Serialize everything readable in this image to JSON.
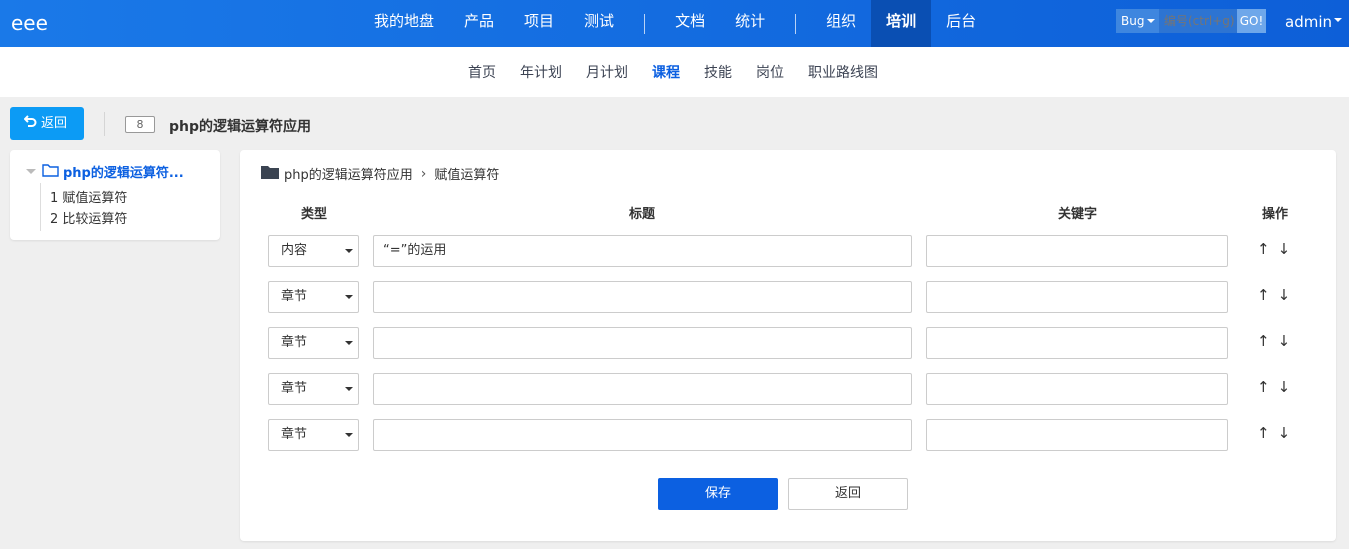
{
  "brand": "eee",
  "mainnav": [
    {
      "label": "我的地盘"
    },
    {
      "label": "产品"
    },
    {
      "label": "项目"
    },
    {
      "label": "测试"
    },
    {
      "label": "文档"
    },
    {
      "label": "统计"
    },
    {
      "label": "组织"
    },
    {
      "label": "培训",
      "active": true
    },
    {
      "label": "后台"
    }
  ],
  "search": {
    "type": "Bug",
    "placeholder": "编号(ctrl+g)",
    "go": "GO!"
  },
  "user": "admin",
  "subnav": [
    {
      "label": "首页"
    },
    {
      "label": "年计划"
    },
    {
      "label": "月计划"
    },
    {
      "label": "课程",
      "active": true
    },
    {
      "label": "技能"
    },
    {
      "label": "岗位"
    },
    {
      "label": "职业路线图"
    }
  ],
  "header": {
    "back_label": "返回",
    "badge": "8",
    "title": "php的逻辑运算符应用"
  },
  "tree": {
    "root": "php的逻辑运算符...",
    "children": [
      "1 赋值运算符",
      "2 比较运算符"
    ]
  },
  "breadcrumb": {
    "parent": "php的逻辑运算符应用",
    "current": "赋值运算符"
  },
  "table": {
    "headers": {
      "type": "类型",
      "title": "标题",
      "keyword": "关键字",
      "ops": "操作"
    },
    "rows": [
      {
        "type": "内容",
        "title": "“=”的运用",
        "keyword": ""
      },
      {
        "type": "章节",
        "title": "",
        "keyword": ""
      },
      {
        "type": "章节",
        "title": "",
        "keyword": ""
      },
      {
        "type": "章节",
        "title": "",
        "keyword": ""
      },
      {
        "type": "章节",
        "title": "",
        "keyword": ""
      }
    ]
  },
  "buttons": {
    "save": "保存",
    "back": "返回"
  }
}
